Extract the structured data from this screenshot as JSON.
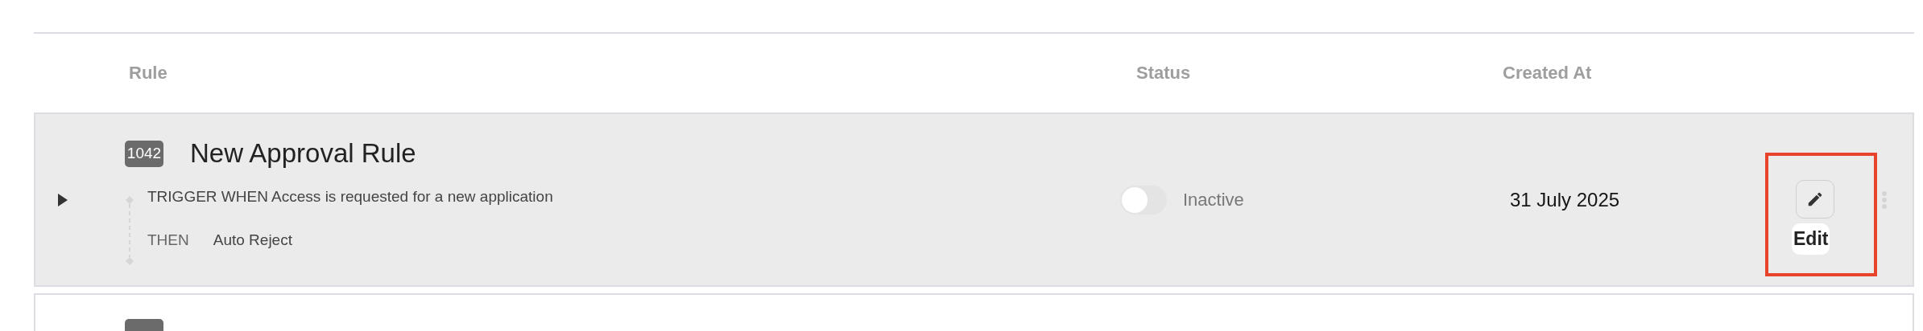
{
  "columns": [
    "Rule",
    "Status",
    "Created At"
  ],
  "rules": [
    {
      "id": "1042",
      "name": "New Approval Rule",
      "expanded": false,
      "trigger": "TRIGGER WHEN Access is requested for a new application",
      "then_label": "THEN",
      "action": "Auto Reject",
      "status": {
        "on": false,
        "label": "Inactive"
      },
      "created_at": "31 July 2025",
      "edit_tooltip": "Edit",
      "highlighted": true
    },
    {
      "highlighted": false
    }
  ]
}
